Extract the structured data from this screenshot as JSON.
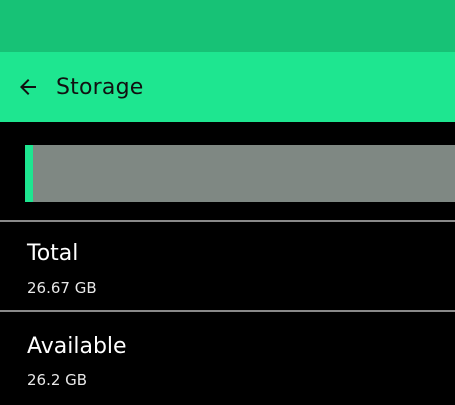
{
  "header": {
    "title": "Storage",
    "back_icon": "arrow-left-icon"
  },
  "colors": {
    "status_bar": "#17c276",
    "app_bar": "#1ee690",
    "usage_fill": "#1ee690",
    "usage_track": "#7f8883",
    "background": "#000000"
  },
  "storage": {
    "used_fraction": 0.0176,
    "items": [
      {
        "title": "Total",
        "value": "26.67 GB"
      },
      {
        "title": "Available",
        "value": "26.2 GB"
      }
    ]
  }
}
